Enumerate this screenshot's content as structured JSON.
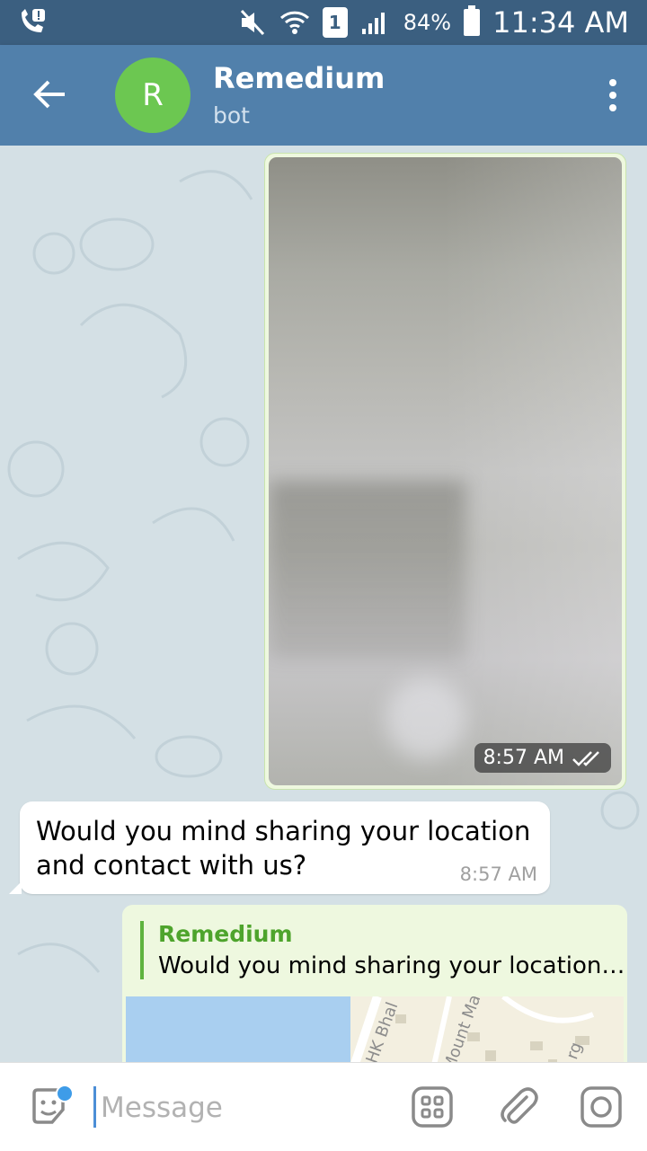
{
  "status_bar": {
    "battery": "84%",
    "time": "11:34 AM",
    "sim": "1"
  },
  "chat_header": {
    "avatar_letter": "R",
    "title": "Remedium",
    "subtitle": "bot"
  },
  "messages": [
    {
      "type": "photo",
      "time": "8:57 AM",
      "status": "read"
    },
    {
      "type": "text",
      "text": "Would you mind sharing your location and contact with us?",
      "time": "8:57 AM"
    },
    {
      "type": "location_reply",
      "reply_name": "Remedium",
      "reply_text": "Would you mind sharing your location…",
      "map_labels": [
        "HK Bhal",
        "Mount Ma",
        "rg"
      ]
    }
  ],
  "input": {
    "placeholder": "Message"
  },
  "colors": {
    "header": "#5180ab",
    "status_bar": "#3b5f80",
    "out_bubble": "#eef8df",
    "avatar": "#6cc751",
    "reply_accent": "#5fb33f"
  }
}
